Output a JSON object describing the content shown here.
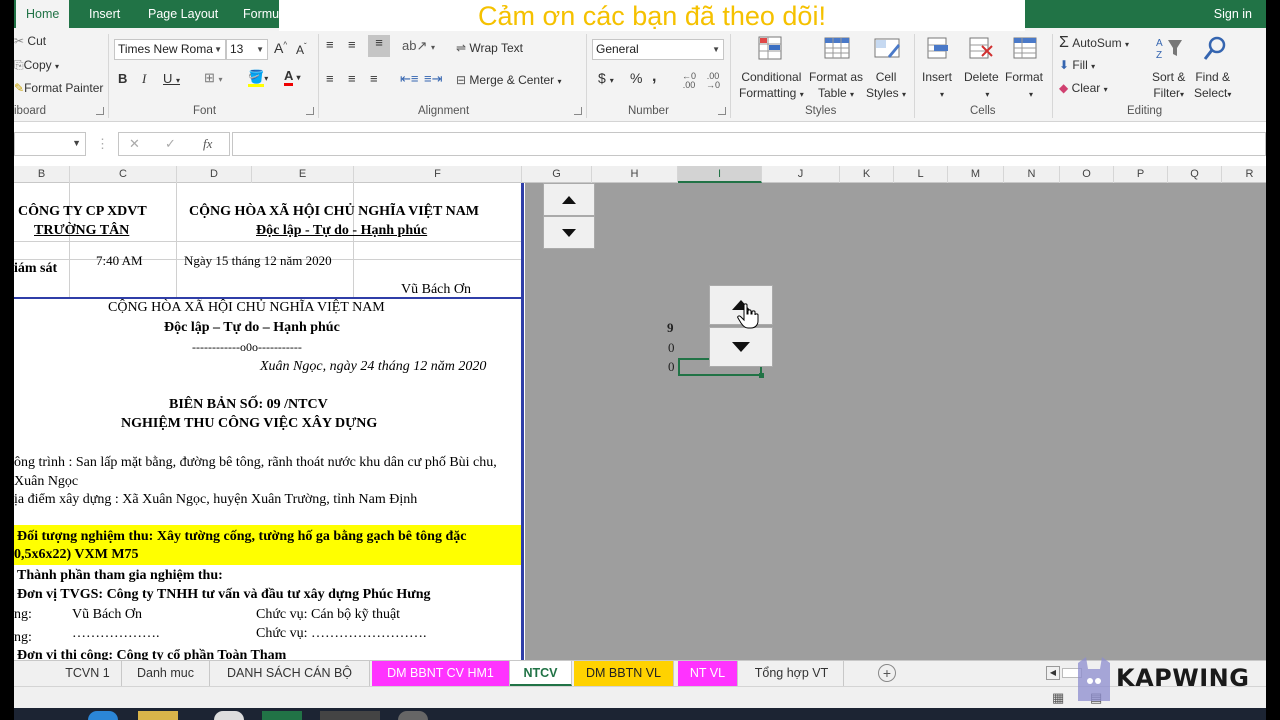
{
  "banner": "Cảm ơn các bạn đã theo dõi!",
  "tabs": [
    "Home",
    "Insert",
    "Page Layout",
    "Formu"
  ],
  "sign_in": "Sign in",
  "ribbon": {
    "clipboard": {
      "cut": "Cut",
      "copy": "Copy",
      "format_painter": "Format Painter",
      "label": "iboard"
    },
    "font": {
      "name": "Times New Roma",
      "size": "13",
      "label": "Font"
    },
    "alignment": {
      "wrap": "Wrap Text",
      "merge": "Merge & Center",
      "label": "Alignment"
    },
    "number": {
      "format": "General",
      "currency": "$",
      "percent": "%",
      "comma": ",",
      "label": "Number"
    },
    "styles": {
      "cond1": "Conditional",
      "cond2": "Formatting",
      "fmt1": "Format as",
      "fmt2": "Table",
      "cell1": "Cell",
      "cell2": "Styles",
      "label": "Styles"
    },
    "cells": {
      "insert": "Insert",
      "delete": "Delete",
      "format": "Format",
      "label": "Cells"
    },
    "editing": {
      "autosum": "AutoSum",
      "fill": "Fill",
      "clear": "Clear",
      "sort1": "Sort &",
      "sort2": "Filter",
      "find1": "Find &",
      "find2": "Select",
      "label": "Editing"
    }
  },
  "formula": {
    "cancel": "✕",
    "enter": "✓",
    "fx": "fx"
  },
  "columns": [
    "B",
    "C",
    "D",
    "E",
    "F",
    "G",
    "H",
    "I",
    "J",
    "K",
    "L",
    "M",
    "N",
    "O",
    "P",
    "Q",
    "R"
  ],
  "sheet": {
    "company1": "CÔNG TY CP XDVT",
    "company2": "TRƯỜNG TÂN",
    "nation1": "CỘNG HÒA XÃ HỘI CHỦ NGHĨA VIỆT NAM",
    "nation2": "Độc lập - Tự do - Hạnh phúc",
    "giamsat": "iám sát",
    "time": "7:40 AM",
    "date_top": "Ngày 15 tháng 12 năm 2020",
    "signer": "Vũ Bách Ơn",
    "nation3": "CỘNG HÒA XÃ HỘI CHỦ NGHĨA VIỆT NAM",
    "nation4": "Độc lập – Tự do – Hạnh phúc",
    "dashes": "------------o0o-----------",
    "place_date": "Xuân Ngọc, ngày 24 tháng 12 năm 2020",
    "bb_title": "BIÊN BẢN SỐ:  09  /NTCV",
    "bb_sub": "NGHIỆM THU CÔNG VIỆC XÂY DỰNG",
    "ct1": "ông trình : San lấp mặt bằng, đường bê tông, rãnh thoát nước khu dân cư phố Bùi chu,",
    "ct2": "Xuân Ngọc",
    "dd": "ịa điểm xây dựng : Xã Xuân Ngọc, huyện Xuân Trường, tỉnh Nam Định",
    "dt1": "Đối tượng nghiệm thu:  Xây tường cống, tường hố ga bằng gạch bê tông đặc",
    "dt2": "0,5x6x22) VXM M75",
    "tp": "Thành phần tham gia nghiệm thu:",
    "dv": "Đơn vị TVGS: Công ty TNHH tư vấn và đầu tư xây dựng Phúc Hưng",
    "ng1": "ng:",
    "name1": "Vũ Bách Ơn",
    "cv1": "Chức vụ: Cán bộ kỹ thuật",
    "ng2": "ng:",
    "dots1": "……………….",
    "cv2": "Chức vụ: …………………….",
    "dvtc": "Đơn vị thi công: Công ty cổ phần Toàn Thạm"
  },
  "values": {
    "v1": "9",
    "v2": "0",
    "v3": "0"
  },
  "sheet_tabs": [
    "TCVN 1",
    "Danh muc",
    "DANH SÁCH CÁN BỘ",
    "DM BBNT CV HM1",
    "NTCV",
    "DM BBTN VL",
    "NT VL",
    "Tổng hợp VT"
  ],
  "watermark": "KAPWING",
  "colors": {
    "excel_green": "#217346",
    "pink_tab": "#ff33ff",
    "yellow_tab": "#ffd200",
    "highlight": "#ffff00",
    "banner_text": "#f5c100"
  }
}
